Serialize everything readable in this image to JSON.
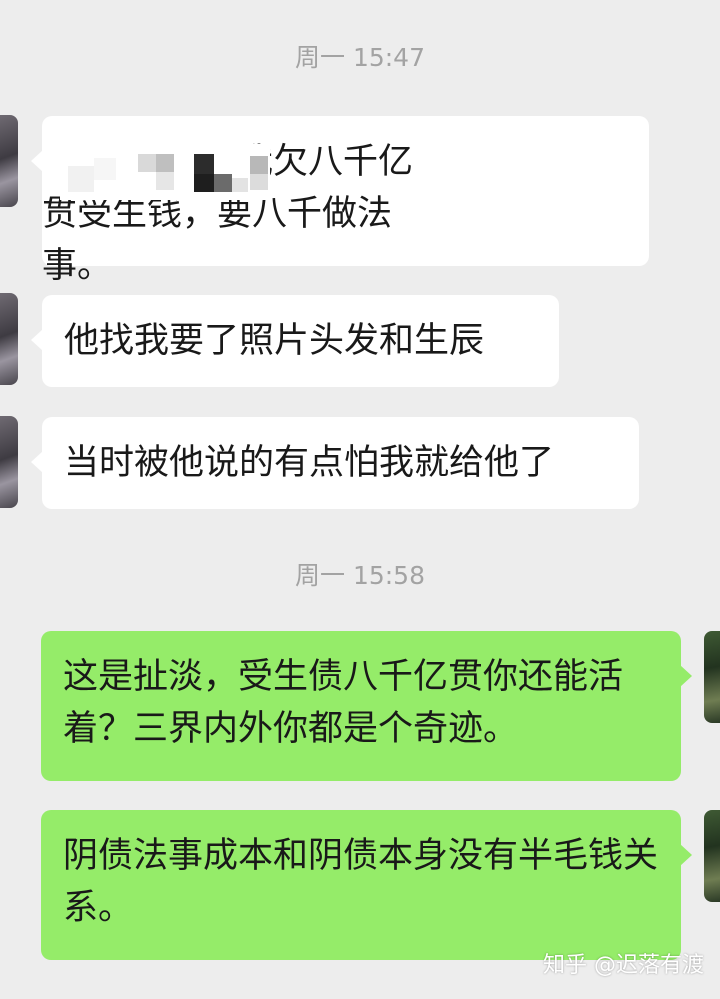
{
  "timestamps": [
    "周一 15:47",
    "周一 15:58"
  ],
  "messages": [
    {
      "side": "left",
      "text": "我欠八千亿贯受生钱，要八千做法事。"
    },
    {
      "side": "left",
      "text": "他找我要了照片头发和生辰"
    },
    {
      "side": "left",
      "text": "当时被他说的有点怕我就给他了"
    },
    {
      "side": "right",
      "text": "这是扯淡，受生债八千亿贯你还能活着？三界内外你都是个奇迹。"
    },
    {
      "side": "right",
      "text": "阴债法事成本和阴债本身没有半毛钱关系。"
    }
  ],
  "watermark": "知乎 @迟落有渡",
  "colors": {
    "background": "#ededed",
    "incoming_bubble": "#ffffff",
    "outgoing_bubble": "#95ec69",
    "timestamp_text": "#a3a3a3"
  },
  "icons": [
    "avatar-contact",
    "avatar-self"
  ]
}
